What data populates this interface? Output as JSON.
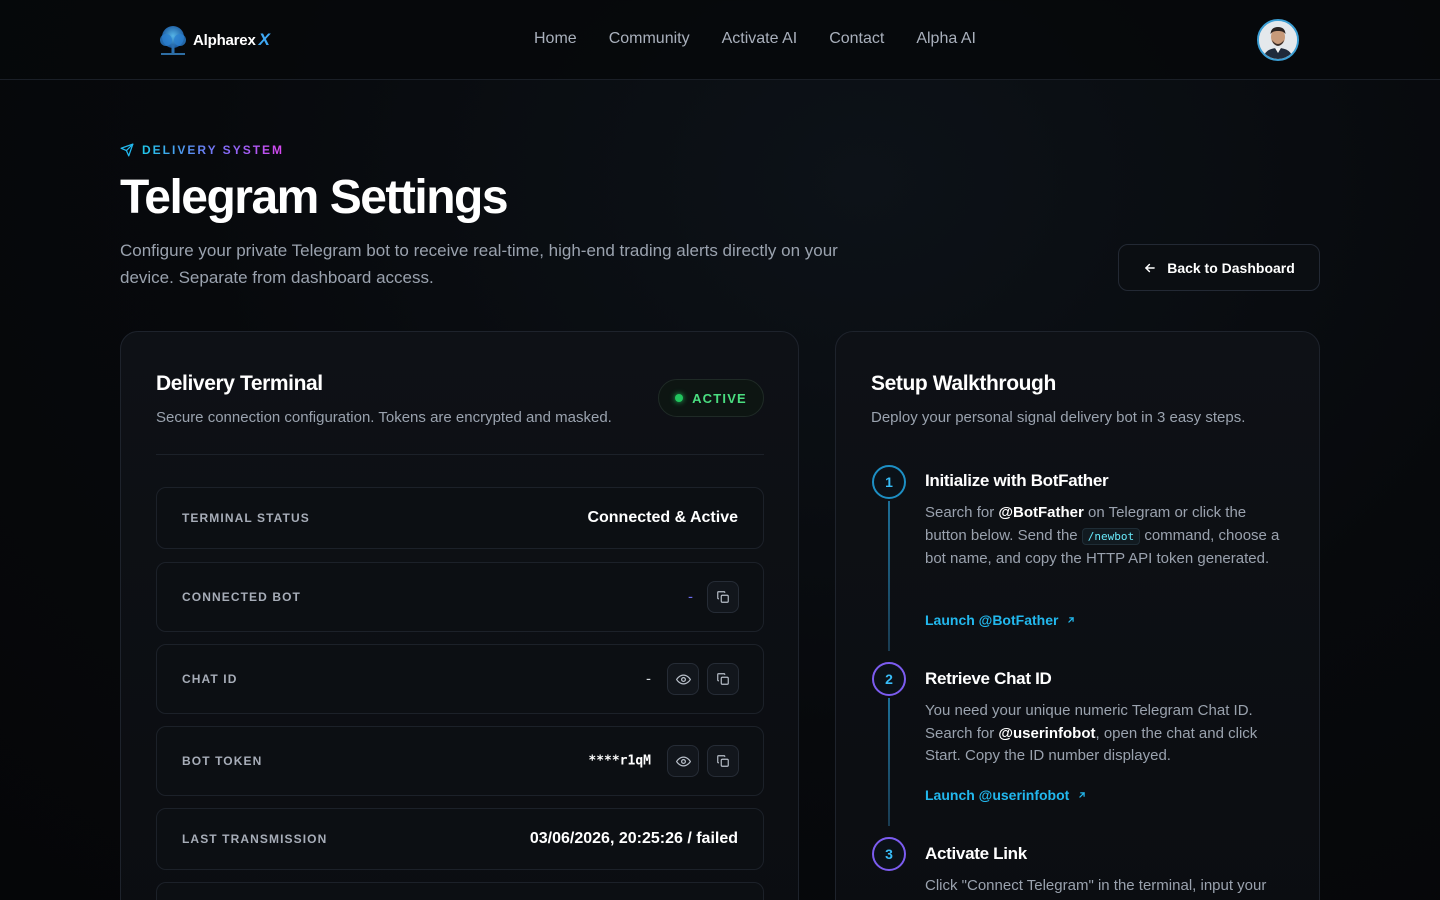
{
  "nav": {
    "brand": "Alpharex",
    "brand_suffix": "X",
    "links": [
      "Home",
      "Community",
      "Activate AI",
      "Contact",
      "Alpha AI"
    ]
  },
  "hero": {
    "eyebrow": "DELIVERY SYSTEM",
    "title": "Telegram Settings",
    "description": "Configure your private Telegram bot to receive real-time, high-end trading alerts directly on your device. Separate from dashboard access.",
    "back_button": "Back to Dashboard"
  },
  "terminal": {
    "title": "Delivery Terminal",
    "subtitle": "Secure connection configuration. Tokens are encrypted and masked.",
    "badge": "ACTIVE",
    "rows": [
      {
        "label": "TERMINAL STATUS",
        "value": "Connected & Active"
      },
      {
        "label": "CONNECTED BOT",
        "value": "-"
      },
      {
        "label": "CHAT ID",
        "value": "-"
      },
      {
        "label": "BOT TOKEN",
        "value": "****r1qM"
      },
      {
        "label": "LAST TRANSMISSION",
        "value": "03/06/2026, 20:25:26 / failed"
      }
    ]
  },
  "walkthrough": {
    "title": "Setup Walkthrough",
    "subtitle": "Deploy your personal signal delivery bot in 3 easy steps.",
    "steps": [
      {
        "number": "1",
        "title": "Initialize with BotFather",
        "text_1": "Search for ",
        "bold_1": "@BotFather",
        "text_2": " on Telegram or click the button below. Send the ",
        "code": "/newbot",
        "text_3": " command, choose a bot name, and copy the HTTP API token generated.",
        "link": "Launch @BotFather"
      },
      {
        "number": "2",
        "title": "Retrieve Chat ID",
        "text_1": "You need your unique numeric Telegram Chat ID. Search for ",
        "bold_1": "@userinfobot",
        "text_2": ", open the chat and click Start. Copy the ID number displayed.",
        "link": "Launch @userinfobot"
      },
      {
        "number": "3",
        "title": "Activate Link",
        "text_1": "Click \"Connect Telegram\" in the terminal, input your"
      }
    ]
  },
  "colors": {
    "accent": "#22b8ee",
    "active_green": "#22c55e",
    "background": "#07090c"
  }
}
